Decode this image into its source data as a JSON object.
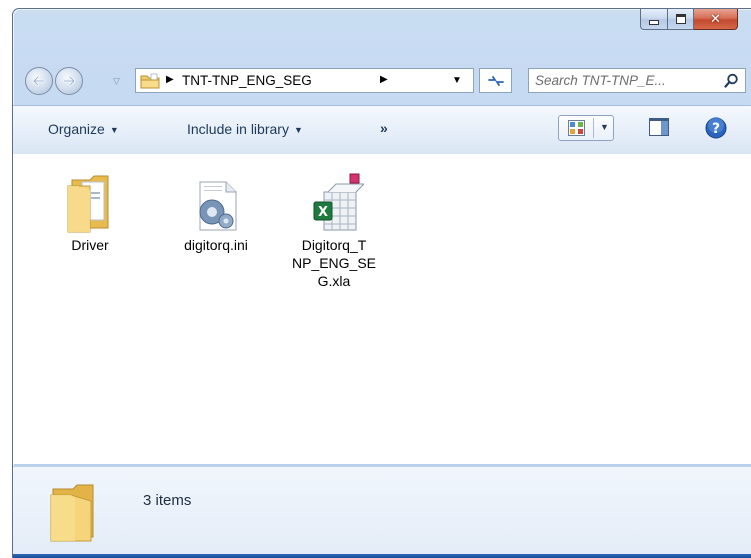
{
  "window": {
    "caption_buttons": {
      "minimize_icon": "minimize-glyph",
      "maximize_icon": "maximize-glyph",
      "close_icon": "close-x-glyph",
      "close_label": "✕"
    }
  },
  "navigation": {
    "back_icon": "back-arrow-icon",
    "forward_icon": "forward-arrow-icon",
    "recent_icon": "chevron-down-icon",
    "address": {
      "folder_icon": "folder-icon",
      "path": "TNT-TNP_ENG_SEG",
      "separator": "▶"
    },
    "refresh_icon": "refresh-arrows-icon",
    "search": {
      "placeholder": "Search TNT-TNP_E...",
      "icon": "magnifier-icon"
    }
  },
  "command_bar": {
    "organize_label": "Organize",
    "include_label": "Include in library",
    "more_label": "»",
    "view_icon": "change-view-icon",
    "pane_icon": "preview-pane-icon",
    "help_icon": "help-icon",
    "caret": "▼"
  },
  "files": [
    {
      "name": "Driver",
      "type": "folder",
      "icon": "folder-with-documents-icon"
    },
    {
      "name": "digitorq.ini",
      "type": "ini",
      "icon": "config-settings-file-icon"
    },
    {
      "name": "Digitorq_T NP_ENG_SE G.xla",
      "type": "xla",
      "icon": "excel-addin-icon"
    }
  ],
  "details": {
    "icon": "folder-icon",
    "status": "3 items"
  },
  "colors": {
    "frame": "#bcd3ee",
    "close": "#c44a30",
    "text": "#1e395b",
    "folder": "#f4d27a"
  }
}
